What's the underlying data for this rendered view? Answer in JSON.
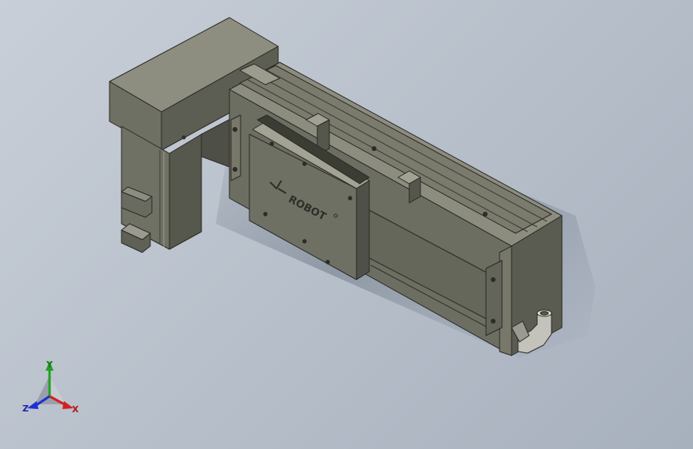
{
  "model": {
    "brand_text": "ROBOT",
    "brand_mark": "registered-mark"
  },
  "triad": {
    "x_label": "X",
    "y_label": "Y",
    "z_label": "Z"
  },
  "colors": {
    "body": "#6e6f63",
    "body_dark": "#4e4f45",
    "body_light": "#8a8b7e",
    "axis_x": "#d42020",
    "axis_y": "#22a022",
    "axis_z": "#2030d0"
  }
}
